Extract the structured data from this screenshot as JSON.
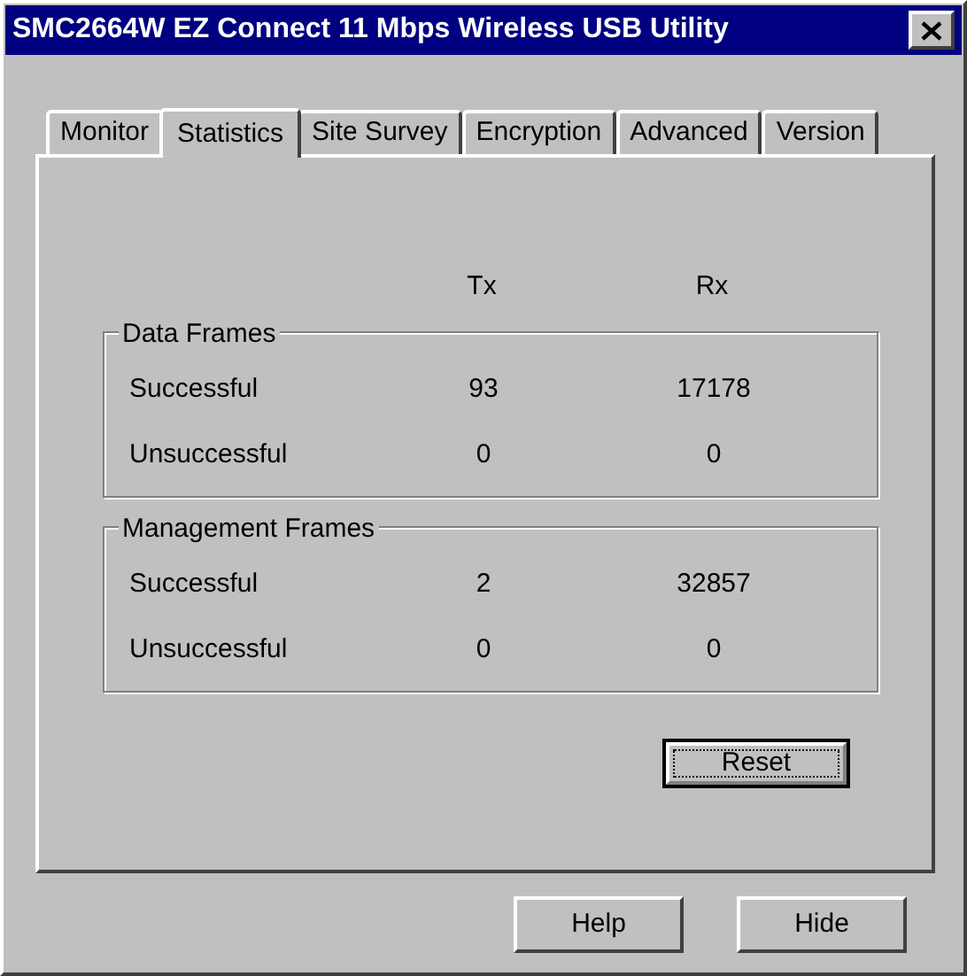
{
  "window": {
    "title": "SMC2664W EZ Connect 11 Mbps Wireless USB Utility"
  },
  "tabs": [
    {
      "label": "Monitor",
      "selected": false
    },
    {
      "label": "Statistics",
      "selected": true
    },
    {
      "label": "Site Survey",
      "selected": false
    },
    {
      "label": "Encryption",
      "selected": false
    },
    {
      "label": "Advanced",
      "selected": false
    },
    {
      "label": "Version",
      "selected": false
    }
  ],
  "columns": [
    "Tx",
    "Rx"
  ],
  "groups": [
    {
      "title": "Data Frames",
      "rows": [
        {
          "label": "Successful",
          "tx": "93",
          "rx": "17178"
        },
        {
          "label": "Unsuccessful",
          "tx": "0",
          "rx": "0"
        }
      ]
    },
    {
      "title": "Management Frames",
      "rows": [
        {
          "label": "Successful",
          "tx": "2",
          "rx": "32857"
        },
        {
          "label": "Unsuccessful",
          "tx": "0",
          "rx": "0"
        }
      ]
    }
  ],
  "reset_button": {
    "label": "Reset",
    "focused": true
  },
  "buttons": [
    "Help",
    "Hide"
  ]
}
